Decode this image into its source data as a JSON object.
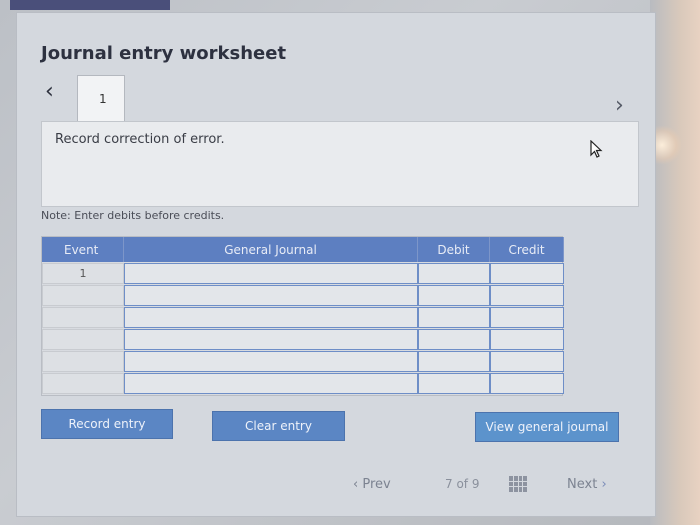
{
  "worksheet": {
    "title": "Journal entry worksheet",
    "current_tab": "1",
    "instruction": "Record correction of error.",
    "note": "Note: Enter debits before credits."
  },
  "table": {
    "headers": {
      "event": "Event",
      "general_journal": "General Journal",
      "debit": "Debit",
      "credit": "Credit"
    },
    "rows": [
      {
        "event": "1",
        "account": "",
        "debit": "",
        "credit": ""
      },
      {
        "event": "",
        "account": "",
        "debit": "",
        "credit": ""
      },
      {
        "event": "",
        "account": "",
        "debit": "",
        "credit": ""
      },
      {
        "event": "",
        "account": "",
        "debit": "",
        "credit": ""
      },
      {
        "event": "",
        "account": "",
        "debit": "",
        "credit": ""
      },
      {
        "event": "",
        "account": "",
        "debit": "",
        "credit": ""
      }
    ]
  },
  "buttons": {
    "record": "Record entry",
    "clear": "Clear entry",
    "view": "View general journal"
  },
  "pager": {
    "prev": "Prev",
    "count": "7 of 9",
    "next": "Next"
  },
  "icons": {
    "prev_tab": "chevron-left-icon",
    "next_tab": "chevron-right-icon",
    "cursor": "mouse-cursor-icon",
    "grid": "grid-icon"
  },
  "colors": {
    "header_blue": "#5d7fc1",
    "button_blue": "#5b86c4",
    "title_text": "#2d3140"
  }
}
